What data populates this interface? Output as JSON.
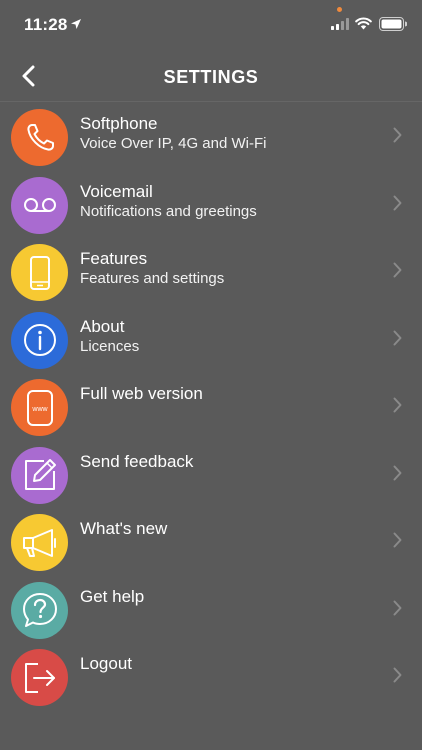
{
  "status_bar": {
    "time": "11:28",
    "location_icon": "location-arrow-icon",
    "signal_icon": "cellular-signal-icon",
    "wifi_icon": "wifi-icon",
    "battery_icon": "battery-icon"
  },
  "nav": {
    "title": "SETTINGS",
    "back_icon": "chevron-left-icon"
  },
  "colors": {
    "background": "#5a5a5a",
    "orange": "#ed6a2f",
    "purple": "#a96bd0",
    "yellow": "#f7c932",
    "blue": "#2c6bd9",
    "teal": "#5aaba4",
    "red": "#d84b47"
  },
  "items": [
    {
      "title": "Softphone",
      "subtitle": "Voice Over IP, 4G and Wi-Fi",
      "icon": "phone-icon",
      "color": "#ed6a2f"
    },
    {
      "title": "Voicemail",
      "subtitle": "Notifications and greetings",
      "icon": "voicemail-icon",
      "color": "#a96bd0"
    },
    {
      "title": "Features",
      "subtitle": "Features and settings",
      "icon": "mobile-device-icon",
      "color": "#f7c932"
    },
    {
      "title": "About",
      "subtitle": "Licences",
      "icon": "info-icon",
      "color": "#2c6bd9"
    },
    {
      "title": "Full web version",
      "subtitle": "",
      "icon": "www-device-icon",
      "color": "#ed6a2f"
    },
    {
      "title": "Send feedback",
      "subtitle": "",
      "icon": "edit-icon",
      "color": "#a96bd0"
    },
    {
      "title": "What's new",
      "subtitle": "",
      "icon": "megaphone-icon",
      "color": "#f7c932"
    },
    {
      "title": "Get help",
      "subtitle": "",
      "icon": "help-bubble-icon",
      "color": "#5aaba4"
    },
    {
      "title": "Logout",
      "subtitle": "",
      "icon": "logout-icon",
      "color": "#d84b47"
    }
  ]
}
